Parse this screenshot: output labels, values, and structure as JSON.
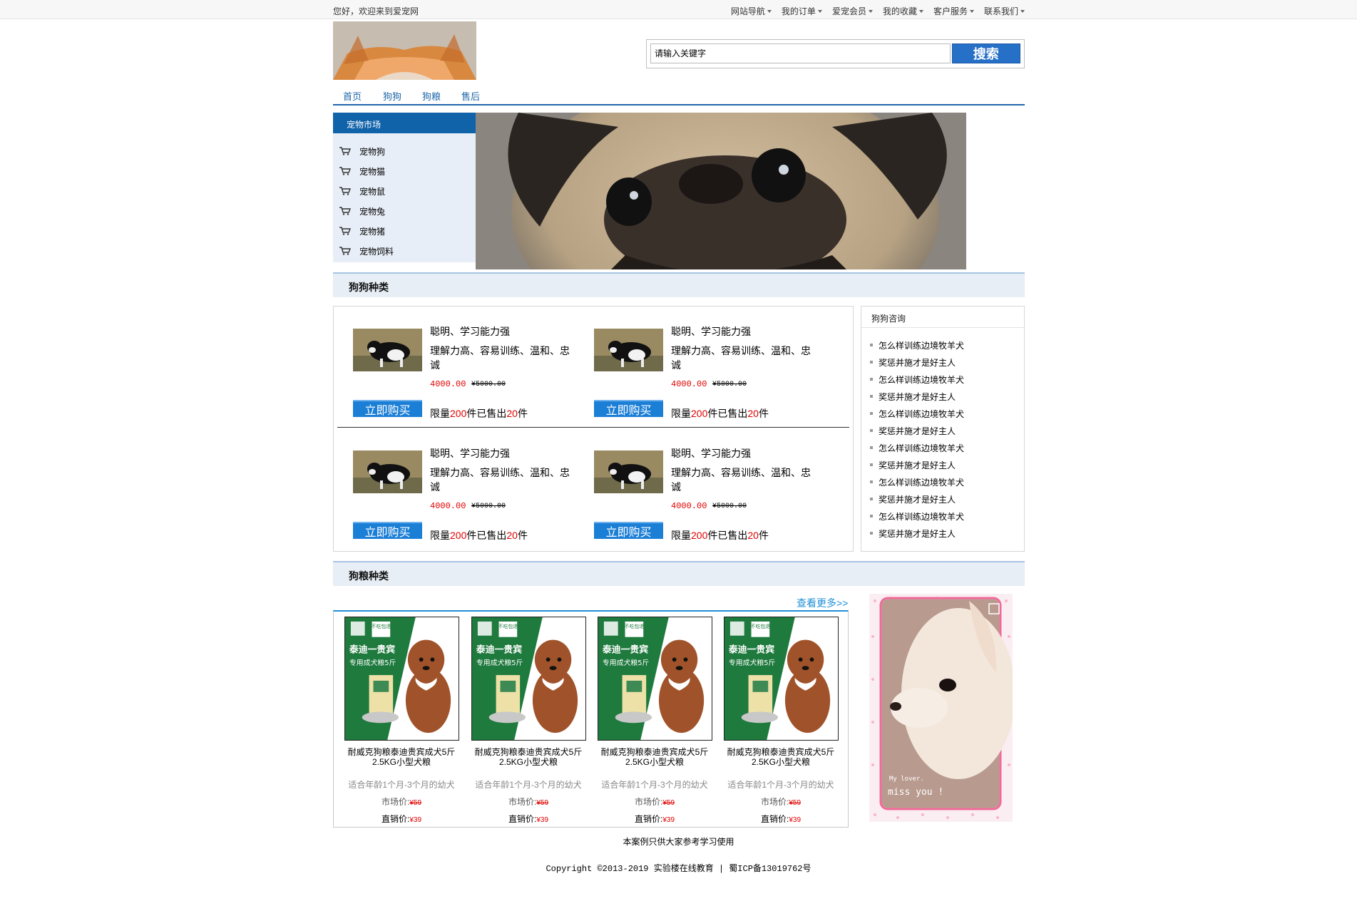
{
  "topbar": {
    "welcome": "您好，欢迎来到爱宠网",
    "nav": [
      "网站导航",
      "我的订单",
      "爱宠会员",
      "我的收藏",
      "客户服务",
      "联系我们"
    ]
  },
  "search": {
    "placeholder": "请输入关键字",
    "button": "搜索"
  },
  "mainnav": [
    "首页",
    "狗狗",
    "狗粮",
    "售后"
  ],
  "sidebar": {
    "title": "宠物市场",
    "items": [
      "宠物狗",
      "宠物猫",
      "宠物鼠",
      "宠物兔",
      "宠物猪",
      "宠物饲料"
    ]
  },
  "sections": {
    "dogs": "狗狗种类",
    "food": "狗粮种类"
  },
  "dog_products": [
    {
      "line1": "聪明、学习能力强",
      "line2": "理解力高、容易训练、温和、忠诚",
      "price": "4000.00",
      "old_price": "¥5000.00",
      "buy": "立即购买",
      "limit_a": "限量",
      "limit_n": "200",
      "limit_b": "件已售出",
      "sold_n": "20",
      "limit_c": "件"
    },
    {
      "line1": "聪明、学习能力强",
      "line2": "理解力高、容易训练、温和、忠诚",
      "price": "4000.00",
      "old_price": "¥5000.00",
      "buy": "立即购买",
      "limit_a": "限量",
      "limit_n": "200",
      "limit_b": "件已售出",
      "sold_n": "20",
      "limit_c": "件"
    },
    {
      "line1": "聪明、学习能力强",
      "line2": "理解力高、容易训练、温和、忠诚",
      "price": "4000.00",
      "old_price": "¥5000.00",
      "buy": "立即购买",
      "limit_a": "限量",
      "limit_n": "200",
      "limit_b": "件已售出",
      "sold_n": "20",
      "limit_c": "件"
    },
    {
      "line1": "聪明、学习能力强",
      "line2": "理解力高、容易训练、温和、忠诚",
      "price": "4000.00",
      "old_price": "¥5000.00",
      "buy": "立即购买",
      "limit_a": "限量",
      "limit_n": "200",
      "limit_b": "件已售出",
      "sold_n": "20",
      "limit_c": "件"
    }
  ],
  "consult": {
    "title": "狗狗咨询",
    "items": [
      "怎么样训练边境牧羊犬",
      "奖惩并施才是好主人",
      "怎么样训练边境牧羊犬",
      "奖惩并施才是好主人",
      "怎么样训练边境牧羊犬",
      "奖惩并施才是好主人",
      "怎么样训练边境牧羊犬",
      "奖惩并施才是好主人",
      "怎么样训练边境牧羊犬",
      "奖惩并施才是好主人",
      "怎么样训练边境牧羊犬",
      "奖惩并施才是好主人"
    ]
  },
  "food": {
    "more": "查看更多>>",
    "items": [
      {
        "name1": "耐威克狗粮泰迪贵宾成犬5斤",
        "name2": "2.5KG小型犬粮",
        "age": "适合年龄1个月-3个月的幼犬",
        "market_label": "市场价:",
        "market": "¥59",
        "direct_label": "直销价:",
        "direct": "¥39",
        "pkg_badge": "不吃包退",
        "pkg_title": "泰迪一贵宾",
        "pkg_sub": "专用成犬粮5斤"
      },
      {
        "name1": "耐威克狗粮泰迪贵宾成犬5斤",
        "name2": "2.5KG小型犬粮",
        "age": "适合年龄1个月-3个月的幼犬",
        "market_label": "市场价:",
        "market": "¥59",
        "direct_label": "直销价:",
        "direct": "¥39",
        "pkg_badge": "不吃包退",
        "pkg_title": "泰迪一贵宾",
        "pkg_sub": "专用成犬粮5斤"
      },
      {
        "name1": "耐威克狗粮泰迪贵宾成犬5斤",
        "name2": "2.5KG小型犬粮",
        "age": "适合年龄1个月-3个月的幼犬",
        "market_label": "市场价:",
        "market": "¥59",
        "direct_label": "直销价:",
        "direct": "¥39",
        "pkg_badge": "不吃包退",
        "pkg_title": "泰迪一贵宾",
        "pkg_sub": "专用成犬粮5斤"
      },
      {
        "name1": "耐威克狗粮泰迪贵宾成犬5斤",
        "name2": "2.5KG小型犬粮",
        "age": "适合年龄1个月-3个月的幼犬",
        "market_label": "市场价:",
        "market": "¥59",
        "direct_label": "直销价:",
        "direct": "¥39",
        "pkg_badge": "不吃包退",
        "pkg_title": "泰迪一贵宾",
        "pkg_sub": "专用成犬粮5斤"
      }
    ]
  },
  "side_photo_caption": {
    "line1": "My lover.",
    "line2": "miss you !"
  },
  "footer": {
    "line1": "本案例只供大家参考学习使用",
    "line2": "Copyright ©2013-2019 实验楼在线教育 | 蜀ICP备13019762号"
  },
  "colors": {
    "accent": "#1d66a8",
    "price_red": "#e10000",
    "buy_blue": "#1c7fd6",
    "search_blue": "#2670c8"
  }
}
